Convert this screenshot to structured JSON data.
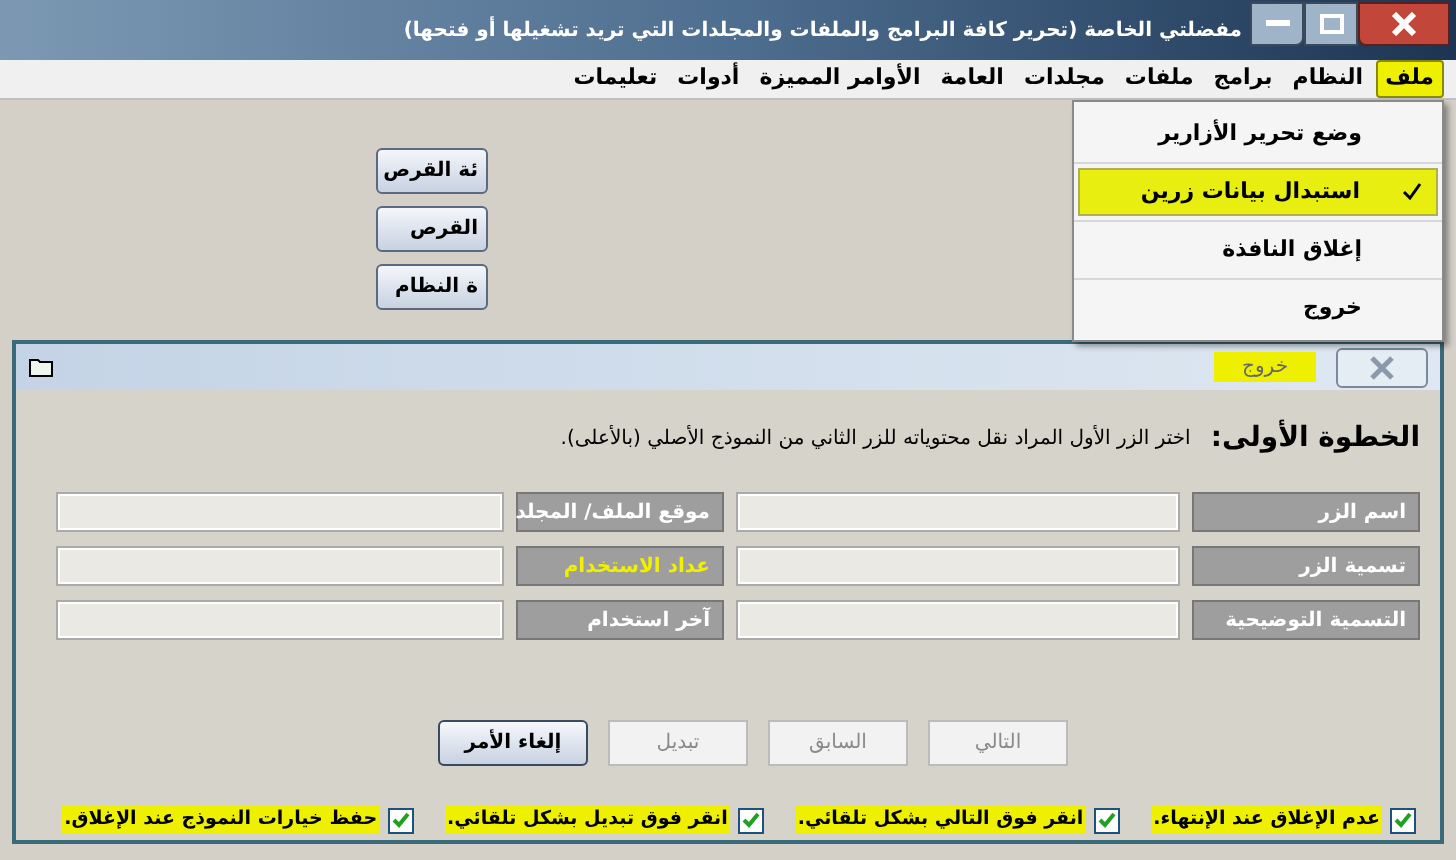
{
  "window": {
    "title": "مفضلتي الخاصة (تحرير كافة البرامج والملفات والمجلدات التي تريد تشغيلها أو فتحها)"
  },
  "menu_bar": [
    {
      "label": "ملف",
      "selected": true
    },
    {
      "label": "النظام",
      "selected": false
    },
    {
      "label": "برامج",
      "selected": false
    },
    {
      "label": "ملفات",
      "selected": false
    },
    {
      "label": "مجلدات",
      "selected": false
    },
    {
      "label": "العامة",
      "selected": false
    },
    {
      "label": "الأوامر المميزة",
      "selected": false
    },
    {
      "label": "أدوات",
      "selected": false
    },
    {
      "label": "تعليمات",
      "selected": false
    }
  ],
  "file_menu": [
    {
      "label": "وضع تحرير الأزارير",
      "checked": false,
      "highlighted": false
    },
    {
      "label": "استبدال بيانات زرين",
      "checked": true,
      "highlighted": true
    },
    {
      "label": "إغلاق النافذة",
      "checked": false,
      "highlighted": false
    },
    {
      "label": "خروج",
      "checked": false,
      "highlighted": false
    }
  ],
  "background_buttons": [
    "ئة القرص",
    "القرص",
    "ة النظام"
  ],
  "dialog": {
    "title": "خروج",
    "title_highlighted": true,
    "heading": "الخطوة الأولى:",
    "instruction": "اختر الزر الأول المراد نقل محتوياته للزر الثاني من النموذج الأصلي (بالأعلى).",
    "field_rows": [
      [
        {
          "label": "اسم الزر",
          "highlighted": false
        },
        {
          "label": "موقع الملف/ المجلد",
          "highlighted": false
        }
      ],
      [
        {
          "label": "تسمية الزر",
          "highlighted": false
        },
        {
          "label": "عداد الاستخدام",
          "highlighted": true
        }
      ],
      [
        {
          "label": "التسمية التوضيحية",
          "highlighted": false
        },
        {
          "label": "آخر استخدام",
          "highlighted": false
        }
      ]
    ],
    "buttons": [
      {
        "label": "التالي",
        "disabled": true
      },
      {
        "label": "السابق",
        "disabled": true
      },
      {
        "label": "تبديل",
        "disabled": true
      },
      {
        "label": "إلغاء الأمر",
        "disabled": false
      }
    ],
    "options": [
      {
        "label": "عدم الإغلاق عند الإنتهاء.",
        "checked": true
      },
      {
        "label": "انقر فوق التالي بشكل تلقائي.",
        "checked": true
      },
      {
        "label": "انقر فوق تبديل بشكل تلقائي.",
        "checked": true
      },
      {
        "label": "حفظ خيارات النموذج عند الإغلاق.",
        "checked": true
      }
    ]
  }
}
